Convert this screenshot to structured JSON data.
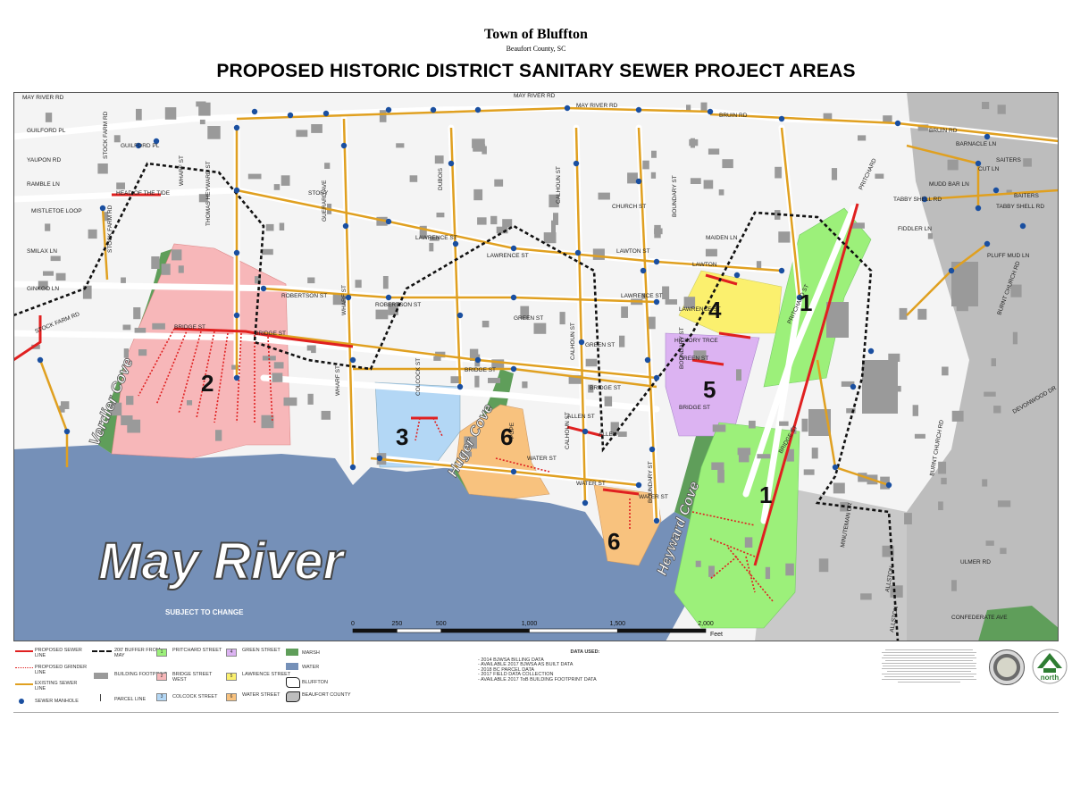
{
  "header": {
    "town": "Town of Bluffton",
    "county": "Beaufort County, SC",
    "title": "PROPOSED HISTORIC DISTRICT SANITARY SEWER PROJECT AREAS"
  },
  "colors": {
    "water": "#7590b8",
    "marsh": "#5f9e5a",
    "area1": "#9cf07a",
    "area2": "#f7b7b9",
    "area3": "#b3d7f5",
    "area4": "#fbf06e",
    "area5": "#dcb3f2",
    "area6": "#f8c27e",
    "proposed_sewer": "#e02020",
    "existing_sewer": "#e0a020",
    "manhole": "#1a4fa0",
    "building": "#9a9a9a",
    "county_area": "#bdbdbd"
  },
  "map": {
    "river_label": "May River",
    "subject_to_change": "SUBJECT TO CHANGE",
    "water_labels": [
      "Verdier Cove",
      "Huger Cove",
      "Heyward Cove"
    ],
    "area_numbers": [
      "1",
      "2",
      "3",
      "4",
      "5",
      "6",
      "6",
      "1"
    ],
    "streets": [
      "MAY RIVER RD",
      "MAY RIVER RD",
      "MAY RIVER RD",
      "BRUIN RD",
      "BRUIN RD",
      "GUILFORD PL",
      "GUILFORD PL",
      "YAUPON RD",
      "RAMBLE LN",
      "MISTLETOE LOOP",
      "SMILAX LN",
      "GINKGO LN",
      "STOCK FARM RD",
      "STOCK FARM RD",
      "STOCK FARM RD",
      "HEAD OF THE TIDE",
      "THOMAS HEYWARD ST",
      "WHARF ST",
      "WHARF ST",
      "WHARF ST",
      "GUERARD AVE",
      "STORY",
      "DUBOIS",
      "CALHOUN ST",
      "CALHOUN ST",
      "CALHOUN ST",
      "CHURCH ST",
      "BOUNDARY ST",
      "BOUNDARY ST",
      "BOUNDARY ST",
      "MAIDEN LN",
      "LAWTON ST",
      "LAWTON",
      "LAWRENCE ST",
      "LAWRENCE ST",
      "LAWRENCE ST",
      "LAWRENCE ST",
      "ROBERTSON ST",
      "ROBERTSON ST",
      "GREEN ST",
      "GREEN ST",
      "GREEN ST",
      "HICKORY TRCE",
      "BRIDGE ST",
      "BRIDGE ST",
      "BRIDGE ST",
      "BRIDGE ST",
      "BRIDGE ST",
      "BRIDGE ST",
      "COLCOCK ST",
      "ALLEN ST",
      "ALLEN",
      "POPE",
      "WATER ST",
      "WATER ST",
      "WATER ST",
      "PRITCHARD ST",
      "PRITCHARD",
      "BARNACLE LN",
      "SAITERS",
      "CUT LN",
      "MUDD BAR LN",
      "TABBY SHELL RD",
      "TABBY SHELL RD",
      "FIDDLER LN",
      "PLUFF MUD LN",
      "BAITERS",
      "BURNT CHURCH RD",
      "BURNT CHURCH RD",
      "DEVONWOOD DR",
      "MINUTEMAN DR",
      "ULMER RD",
      "CONFEDERATE AVE",
      "ALLSTON",
      "ALLSTON"
    ]
  },
  "scalebar": {
    "ticks": [
      "0",
      "250",
      "500",
      "1,000",
      "1,500",
      "2,000"
    ],
    "values": [
      0,
      250,
      500,
      1000,
      1500,
      2000
    ],
    "unit": "Feet"
  },
  "legend": {
    "proposed_sewer": "PROPOSED SEWER LINE",
    "proposed_grinder": "PROPOSED GRINDER LINE",
    "existing_sewer": "EXISTING SEWER LINE",
    "manhole": "SEWER MANHOLE",
    "buffer": "200' BUFFER FROM MAY",
    "building": "BUILDING FOOTPRINT",
    "parcel": "PARCEL LINE",
    "areas": [
      {
        "num": "1",
        "label": "PRITCHARD STREET"
      },
      {
        "num": "2",
        "label": "BRIDGE STREET WEST"
      },
      {
        "num": "3",
        "label": "COLCOCK STREET"
      },
      {
        "num": "4",
        "label": "GREEN STREET"
      },
      {
        "num": "5",
        "label": "LAWRENCE STREET"
      },
      {
        "num": "6",
        "label": "WATER STREET"
      }
    ],
    "marsh": "MARSH",
    "water": "WATER",
    "bluffton": "BLUFFTON",
    "beaufort": "BEAUFORT COUNTY"
  },
  "data_used": {
    "heading": "DATA USED:",
    "items": [
      "- 2014 BJWSA BILLING DATA",
      "- AVAILABLE 2017 BJWSA AS BUILT DATA",
      "- 2018 BC PARCEL DATA",
      "- 2017 FIELD DATA COLLECTION",
      "- AVAILABLE 2017 ToB BUILDING FOOTPRINT DATA"
    ]
  },
  "north_label": "north"
}
